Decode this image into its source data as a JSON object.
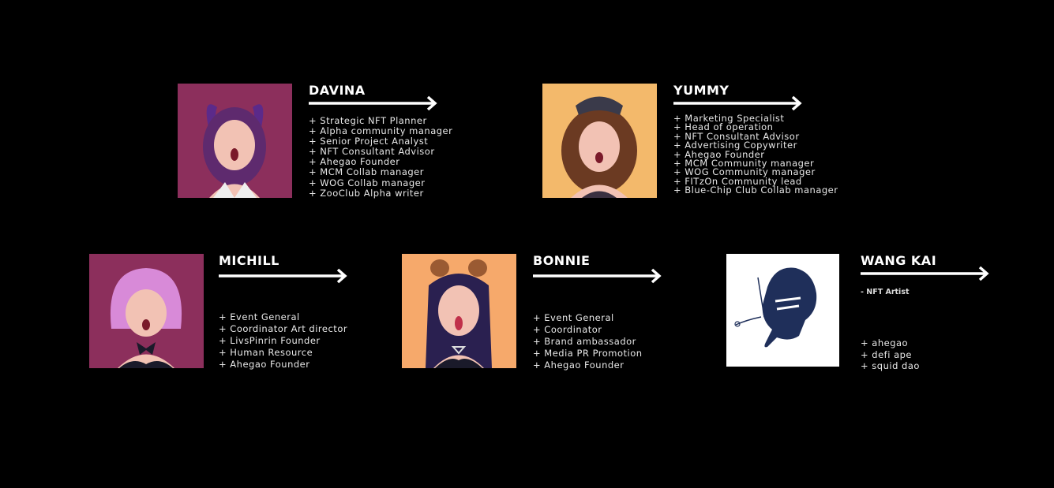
{
  "team": [
    {
      "name": "DAVINA",
      "portrait_icon": "avatar-purple-horns",
      "roles": [
        "+ Strategic NFT Planner",
        "+ Alpha community manager",
        "+ Senior Project Analyst",
        "+ NFT Consultant Advisor",
        "+ Ahegao Founder",
        "+ MCM Collab manager",
        "+ WOG Collab manager",
        "+ ZooClub Alpha writer"
      ]
    },
    {
      "name": "YUMMY",
      "portrait_icon": "avatar-brown-hair-cap",
      "roles": [
        "+ Marketing Specialist",
        "+ Head of operation",
        "+ NFT Consultant Advisor",
        "+ Advertising Copywriter",
        "+ Ahegao Founder",
        "+ MCM Community manager",
        "+ WOG Community manager",
        "+ FITzOn Community lead",
        "+ Blue-Chip Club Collab manager"
      ]
    },
    {
      "name": "MICHILL",
      "portrait_icon": "avatar-pink-bob",
      "roles": [
        "+ Event General",
        "+ Coordinator Art director",
        "+ LivsPinrin Founder",
        "+ Human Resource",
        "+ Ahegao Founder"
      ]
    },
    {
      "name": "BONNIE",
      "portrait_icon": "avatar-bear-ears",
      "roles": [
        "+ Event General",
        "+ Coordinator",
        "+ Brand ambassador",
        "+ Media PR Promotion",
        "+ Ahegao Founder"
      ]
    },
    {
      "name": "WANG KAI",
      "subtitle": "- NFT Artist",
      "portrait_icon": "avatar-line-art-profile",
      "roles": [
        "+ ahegao",
        "+ defi ape",
        "+ squid dao"
      ]
    }
  ]
}
